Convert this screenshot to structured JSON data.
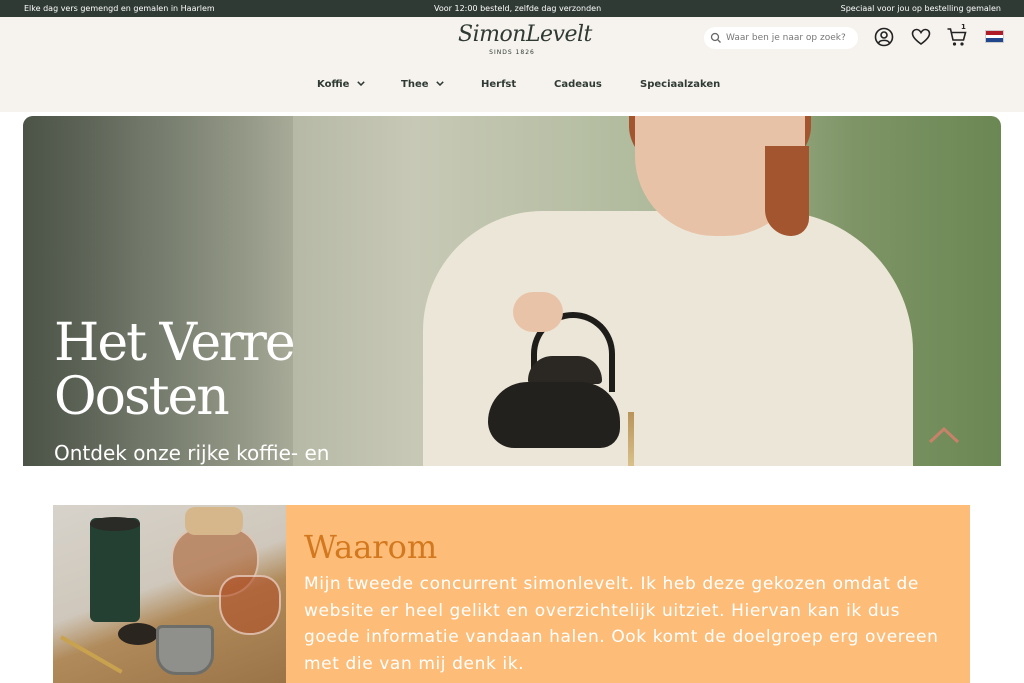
{
  "topbar": {
    "left": "Elke dag vers gemengd en gemalen in Haarlem",
    "center": "Voor 12:00 besteld, zelfde dag verzonden",
    "right": "Speciaal voor jou op bestelling gemalen"
  },
  "header": {
    "logo_main": "SimonLevelt",
    "logo_sub": "SINDS 1826",
    "search_placeholder": "Waar ben je naar op zoek?",
    "cart_count": "1",
    "flag": {
      "colors": [
        "#ae1c28",
        "#ffffff",
        "#21468b"
      ]
    }
  },
  "nav": {
    "items": [
      {
        "label": "Koffie",
        "has_dropdown": true
      },
      {
        "label": "Thee",
        "has_dropdown": true
      },
      {
        "label": "Herfst",
        "has_dropdown": false
      },
      {
        "label": "Cadeaus",
        "has_dropdown": false
      },
      {
        "label": "Speciaalzaken",
        "has_dropdown": false
      }
    ]
  },
  "hero": {
    "title_line1": "Het Verre",
    "title_line2": "Oosten",
    "subtitle": "Ontdek onze rijke koffie- en"
  },
  "card": {
    "title": "Waarom",
    "text": "Mijn tweede concurrent simonlevelt. Ik heb deze gekozen omdat de website er heel gelikt en overzichtelijk uitziet. Hiervan kan ik dus goede informatie vandaan halen. Ook komt de doelgroep erg overeen met die van mij denk ik."
  },
  "colors": {
    "topbar_bg": "#2f3a34",
    "header_bg": "#f6f3ee",
    "card_bg": "#fdbd78",
    "card_title": "#d3781f",
    "scroll_up_icon": "#c8826a"
  },
  "icons": [
    "search-icon",
    "account-icon",
    "heart-icon",
    "cart-icon",
    "chevron-down-icon",
    "chevron-up-icon"
  ]
}
